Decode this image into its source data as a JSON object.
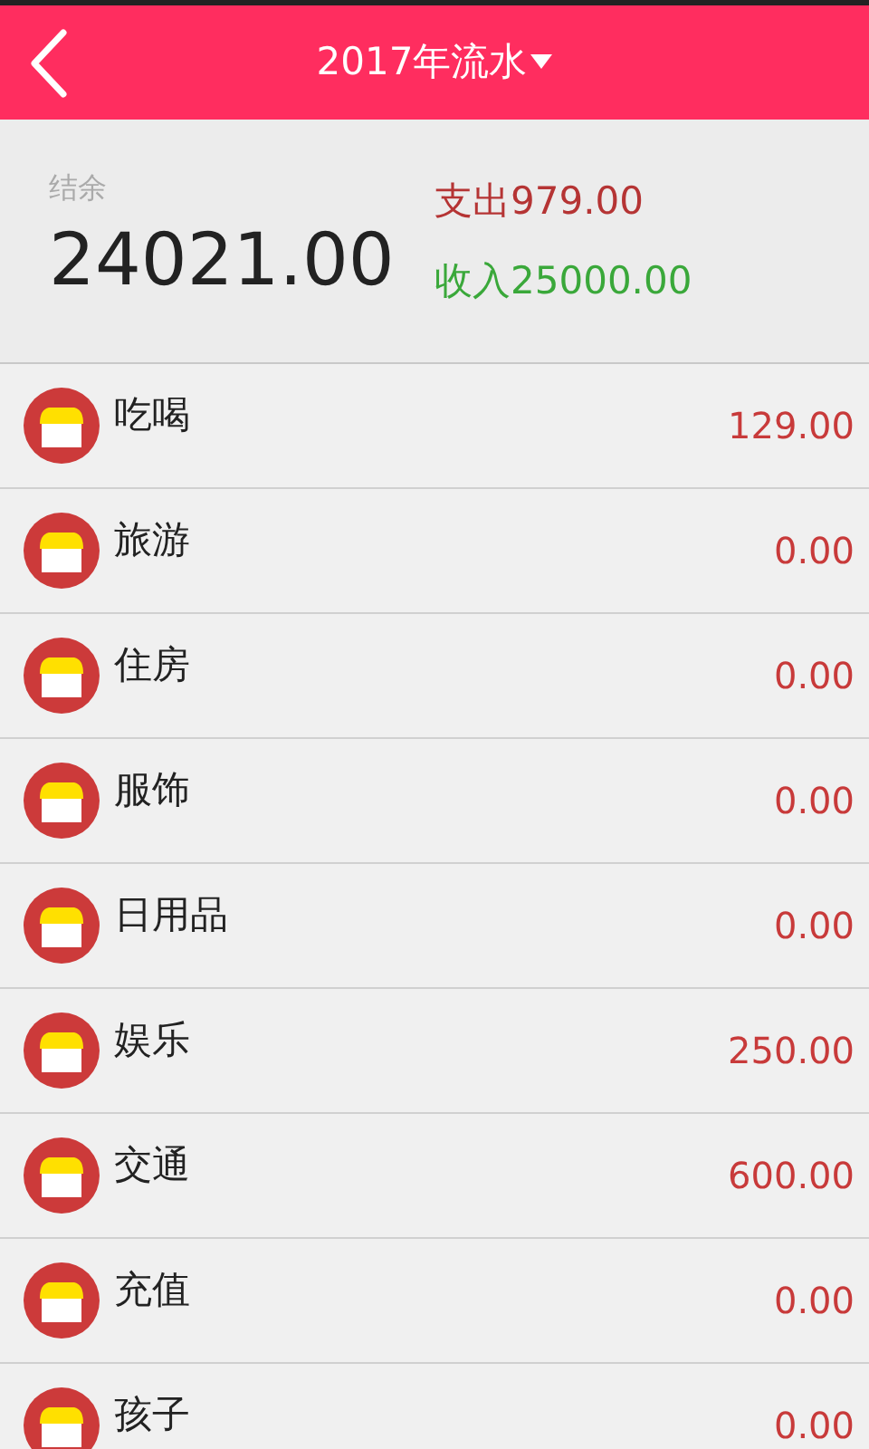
{
  "header": {
    "title": "2017年流水"
  },
  "summary": {
    "balance_label": "结余",
    "balance": "24021.00",
    "expense": "支出979.00",
    "income": "收入25000.00"
  },
  "categories": [
    {
      "name": "吃喝",
      "amount": "129.00"
    },
    {
      "name": "旅游",
      "amount": "0.00"
    },
    {
      "name": "住房",
      "amount": "0.00"
    },
    {
      "name": "服饰",
      "amount": "0.00"
    },
    {
      "name": "日用品",
      "amount": "0.00"
    },
    {
      "name": "娱乐",
      "amount": "250.00"
    },
    {
      "name": "交通",
      "amount": "600.00"
    },
    {
      "name": "充值",
      "amount": "0.00"
    },
    {
      "name": "孩子",
      "amount": "0.00"
    }
  ]
}
